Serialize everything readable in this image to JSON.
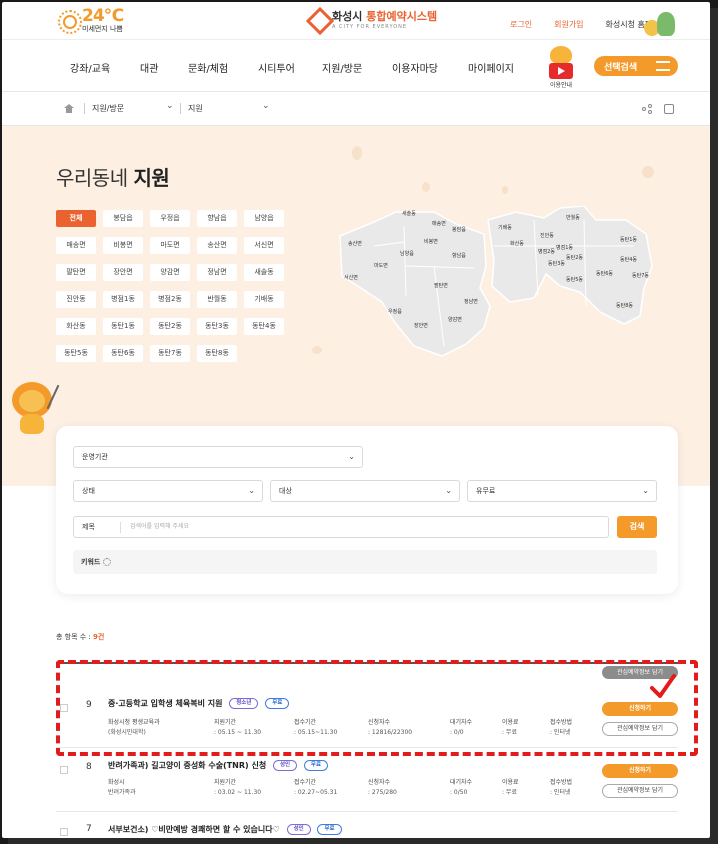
{
  "header": {
    "temperature": "24℃",
    "dust_label": "미세먼지 나쁨",
    "logo_city": "화성시",
    "logo_system": "통합예약시스템",
    "logo_sub": "A CITY FOR EVERYONE",
    "login": "로그인",
    "signup": "회원가입",
    "homepage": "화성시청 홈페이지"
  },
  "nav": {
    "items": [
      "강좌/교육",
      "대관",
      "문화/체험",
      "시티투어",
      "지원/방문",
      "이용자마당",
      "마이페이지"
    ],
    "video_label": "이용안내",
    "select_search": "선택검색"
  },
  "breadcrumb": {
    "level1": "지원/방문",
    "level2": "지원"
  },
  "hero": {
    "title_prefix": "우리동네",
    "title_bold": "지원",
    "chips": [
      "전체",
      "봉담읍",
      "우정읍",
      "향남읍",
      "남양읍",
      "매송면",
      "비봉면",
      "마도면",
      "송산면",
      "서신면",
      "팔탄면",
      "장안면",
      "양감면",
      "정남면",
      "새솔동",
      "진안동",
      "병점1동",
      "병점2동",
      "반월동",
      "기배동",
      "화산동",
      "동탄1동",
      "동탄2동",
      "동탄3동",
      "동탄4동",
      "동탄5동",
      "동탄6동",
      "동탄7동",
      "동탄8동"
    ],
    "map_labels": [
      "새솔동",
      "매송면",
      "송산면",
      "비봉면",
      "봉담읍",
      "남양읍",
      "마도면",
      "서신면",
      "팔탄면",
      "향남읍",
      "우정읍",
      "장안면",
      "양감면",
      "정남면",
      "기배동",
      "화산동",
      "진안동",
      "반월동",
      "병점1동",
      "병점2동",
      "동탄1동",
      "동탄2동",
      "동탄3동",
      "동탄4동",
      "동탄5동",
      "동탄6동",
      "동탄7동",
      "동탄8동"
    ]
  },
  "search": {
    "org_placeholder": "운영기관",
    "status": "상태",
    "target": "대상",
    "fee": "유무료",
    "field": "제목",
    "keyword_placeholder": "검색어를 입력해 주세요",
    "button": "검색",
    "keyword_label": "키워드"
  },
  "results": {
    "count_label": "총 항목 수 :",
    "count_value": "9건",
    "fav_all": "관심예약정보 담기",
    "rows": [
      {
        "num": "9",
        "title": "중·고등학교 입학생 체육복비 지원",
        "tags": [
          "청소년",
          "무료"
        ],
        "org": "화성시청 평생교육과",
        "org2": "(화성시민대학)",
        "period_label": "지원기간",
        "period": ": 05.15 ~ 11.30",
        "recv_label": "접수기간",
        "recv": ": 05.15~11.30",
        "applicants_label": "신청자수",
        "applicants": ": 12816/22300",
        "waiting_label": "대기자수",
        "waiting": ": 0/0",
        "fee_label": "이용료",
        "fee": ": 무료",
        "method_label": "접수방법",
        "method": ": 인터넷",
        "apply": "신청하기",
        "fav": "관심예약정보 담기"
      },
      {
        "num": "8",
        "title": "반려가족과) 길고양이 중성화 수술(TNR) 신청",
        "tags": [
          "성인",
          "무료"
        ],
        "org": "화성시",
        "org2": "반려가족과",
        "period_label": "지원기간",
        "period": ": 03.02 ~ 11.30",
        "recv_label": "접수기간",
        "recv": ": 02.27~05.31",
        "applicants_label": "신청자수",
        "applicants": ": 275/280",
        "waiting_label": "대기자수",
        "waiting": ": 0/50",
        "fee_label": "이용료",
        "fee": ": 무료",
        "method_label": "접수방법",
        "method": ": 인터넷",
        "apply": "신청하기",
        "fav": "관심예약정보 담기"
      },
      {
        "num": "7",
        "title": "서부보건소) ♡비만예방 경쾌하면 할 수 있습니다♡",
        "tags": [
          "성인",
          "무료"
        ]
      }
    ]
  },
  "colors": {
    "accent": "#f39a2b",
    "brand": "#e9622f",
    "hero_bg": "#fdf0e2",
    "highlight": "#e21b1b"
  }
}
